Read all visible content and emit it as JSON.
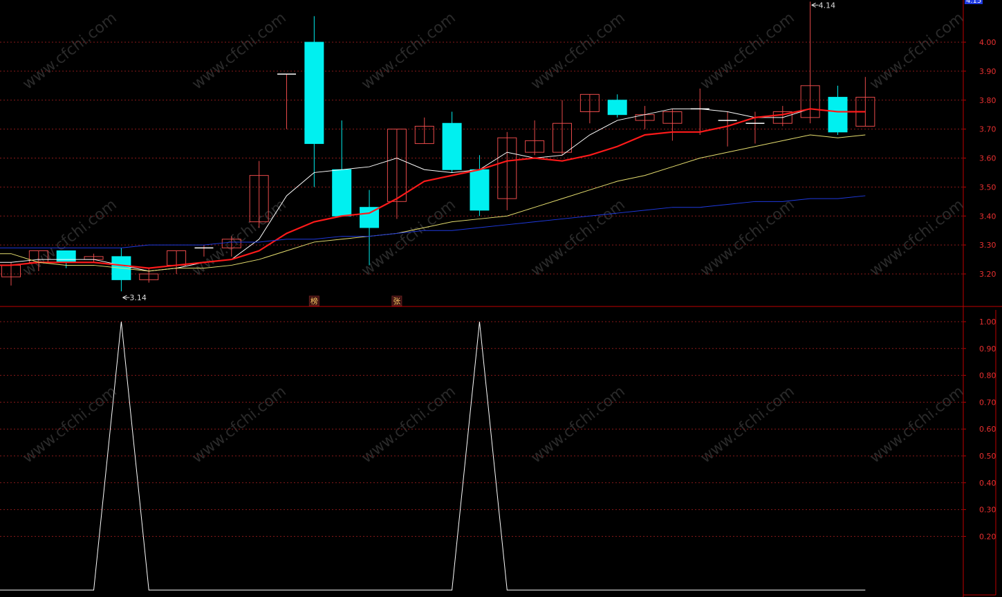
{
  "colors": {
    "background": "#000000",
    "up": "#e84a4a",
    "down": "#00f0f0",
    "grid": "#8b1a1a",
    "axis": "#c00000",
    "axis_text": "#e83030",
    "ma_white": "#ffffff",
    "ma_red": "#ff1a1a",
    "ma_yellow": "#e8e070",
    "ma_blue": "#1f3ae0",
    "watermark": "#2a2a2a"
  },
  "watermark": "www.cfchi.com",
  "chart_data": [
    {
      "type": "candlestick",
      "title": "",
      "ylim": [
        3.1,
        4.16
      ],
      "grid": true,
      "y_ticks": [
        "4.00",
        "3.90",
        "3.80",
        "3.70",
        "3.60",
        "3.50",
        "3.40",
        "3.30",
        "3.20"
      ],
      "top_price_label": "4.15",
      "candles": [
        {
          "open": 3.19,
          "close": 3.23,
          "high": 3.24,
          "low": 3.16
        },
        {
          "open": 3.24,
          "close": 3.28,
          "high": 3.28,
          "low": 3.21
        },
        {
          "open": 3.28,
          "close": 3.24,
          "high": 3.28,
          "low": 3.22
        },
        {
          "open": 3.25,
          "close": 3.26,
          "high": 3.27,
          "low": 3.24
        },
        {
          "open": 3.26,
          "close": 3.18,
          "high": 3.29,
          "low": 3.14
        },
        {
          "open": 3.18,
          "close": 3.2,
          "high": 3.22,
          "low": 3.17
        },
        {
          "open": 3.23,
          "close": 3.28,
          "high": 3.28,
          "low": 3.2
        },
        {
          "open": 3.29,
          "close": 3.29,
          "high": 3.3,
          "low": 3.26
        },
        {
          "open": 3.29,
          "close": 3.32,
          "high": 3.33,
          "low": 3.26
        },
        {
          "open": 3.38,
          "close": 3.54,
          "high": 3.59,
          "low": 3.36
        },
        {
          "open": 3.89,
          "close": 3.89,
          "high": 3.89,
          "low": 3.7
        },
        {
          "open": 4.0,
          "close": 3.65,
          "high": 4.09,
          "low": 3.5
        },
        {
          "open": 3.56,
          "close": 3.4,
          "high": 3.73,
          "low": 3.4
        },
        {
          "open": 3.43,
          "close": 3.36,
          "high": 3.49,
          "low": 3.23
        },
        {
          "open": 3.45,
          "close": 3.7,
          "high": 3.7,
          "low": 3.39
        },
        {
          "open": 3.65,
          "close": 3.71,
          "high": 3.74,
          "low": 3.65
        },
        {
          "open": 3.72,
          "close": 3.56,
          "high": 3.76,
          "low": 3.55
        },
        {
          "open": 3.56,
          "close": 3.42,
          "high": 3.61,
          "low": 3.4
        },
        {
          "open": 3.46,
          "close": 3.67,
          "high": 3.69,
          "low": 3.42
        },
        {
          "open": 3.62,
          "close": 3.66,
          "high": 3.73,
          "low": 3.61
        },
        {
          "open": 3.62,
          "close": 3.72,
          "high": 3.8,
          "low": 3.61
        },
        {
          "open": 3.76,
          "close": 3.82,
          "high": 3.82,
          "low": 3.72
        },
        {
          "open": 3.8,
          "close": 3.75,
          "high": 3.82,
          "low": 3.74
        },
        {
          "open": 3.73,
          "close": 3.75,
          "high": 3.78,
          "low": 3.7
        },
        {
          "open": 3.72,
          "close": 3.76,
          "high": 3.77,
          "low": 3.66
        },
        {
          "open": 3.77,
          "close": 3.77,
          "high": 3.84,
          "low": 3.68
        },
        {
          "open": 3.73,
          "close": 3.73,
          "high": 3.76,
          "low": 3.64
        },
        {
          "open": 3.72,
          "close": 3.72,
          "high": 3.76,
          "low": 3.65
        },
        {
          "open": 3.72,
          "close": 3.76,
          "high": 3.78,
          "low": 3.71
        },
        {
          "open": 3.74,
          "close": 3.85,
          "high": 4.14,
          "low": 3.72
        },
        {
          "open": 3.81,
          "close": 3.69,
          "high": 3.85,
          "low": 3.68
        },
        {
          "open": 3.71,
          "close": 3.81,
          "high": 3.88,
          "low": 3.71
        }
      ],
      "moving_averages": [
        {
          "color": "white",
          "values": [
            3.24,
            3.25,
            3.25,
            3.25,
            3.23,
            3.21,
            3.22,
            3.24,
            3.25,
            3.32,
            3.47,
            3.55,
            3.56,
            3.57,
            3.6,
            3.56,
            3.55,
            3.56,
            3.62,
            3.6,
            3.61,
            3.68,
            3.73,
            3.75,
            3.77,
            3.77,
            3.76,
            3.74,
            3.74,
            3.77,
            3.76,
            3.76
          ]
        },
        {
          "color": "red",
          "values": [
            3.23,
            3.24,
            3.24,
            3.24,
            3.23,
            3.22,
            3.23,
            3.24,
            3.25,
            3.28,
            3.34,
            3.38,
            3.4,
            3.41,
            3.46,
            3.52,
            3.54,
            3.56,
            3.59,
            3.6,
            3.59,
            3.61,
            3.64,
            3.68,
            3.69,
            3.69,
            3.71,
            3.74,
            3.75,
            3.77,
            3.76,
            3.76
          ]
        },
        {
          "color": "yellow",
          "values": [
            3.27,
            3.24,
            3.23,
            3.23,
            3.22,
            3.21,
            3.22,
            3.22,
            3.23,
            3.25,
            3.28,
            3.31,
            3.32,
            3.33,
            3.34,
            3.36,
            3.38,
            3.39,
            3.4,
            3.43,
            3.46,
            3.49,
            3.52,
            3.54,
            3.57,
            3.6,
            3.62,
            3.64,
            3.66,
            3.68,
            3.67,
            3.68
          ]
        },
        {
          "color": "blue",
          "values": [
            3.29,
            3.29,
            3.29,
            3.29,
            3.29,
            3.3,
            3.3,
            3.3,
            3.31,
            3.31,
            3.32,
            3.32,
            3.33,
            3.33,
            3.34,
            3.35,
            3.35,
            3.36,
            3.37,
            3.38,
            3.39,
            3.4,
            3.41,
            3.42,
            3.43,
            3.43,
            3.44,
            3.45,
            3.45,
            3.46,
            3.46,
            3.47
          ]
        }
      ],
      "annotations": [
        {
          "text": "3.14",
          "candle_index": 4,
          "anchor": "low"
        },
        {
          "text": "4.14",
          "candle_index": 29,
          "anchor": "high"
        }
      ],
      "markers": [
        {
          "text": "榜",
          "candle_index": 11
        },
        {
          "text": "张",
          "candle_index": 14
        }
      ]
    },
    {
      "type": "line",
      "title": "",
      "ylim": [
        0.0,
        1.05
      ],
      "grid": true,
      "y_ticks": [
        "1.00",
        "0.90",
        "0.80",
        "0.70",
        "0.60",
        "0.50",
        "0.40",
        "0.30",
        "0.20"
      ],
      "values": [
        0,
        0,
        0,
        0,
        1,
        0,
        0,
        0,
        0,
        0,
        0,
        0,
        0,
        0,
        0,
        0,
        0,
        1,
        0,
        0,
        0,
        0,
        0,
        0,
        0,
        0,
        0,
        0,
        0,
        0,
        0,
        0
      ]
    }
  ]
}
